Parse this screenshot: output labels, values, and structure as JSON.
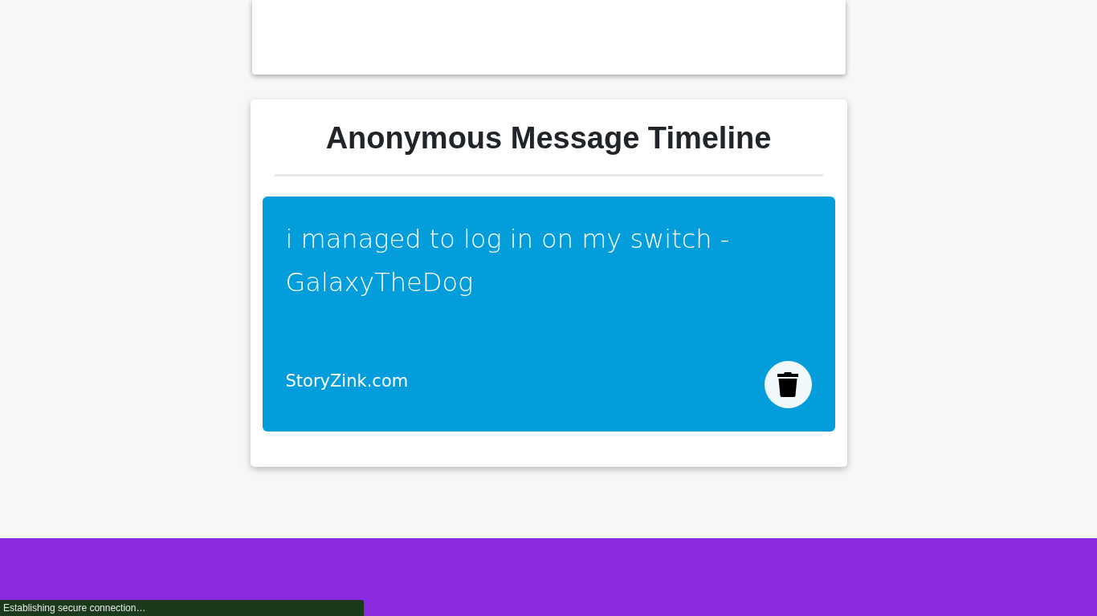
{
  "timeline": {
    "title": "Anonymous Message Timeline",
    "messages": [
      {
        "text": "i managed to log in on my switch - GalaxyTheDog",
        "site": "StoryZink.com"
      }
    ]
  },
  "status_bubble": "Establishing secure connection…"
}
